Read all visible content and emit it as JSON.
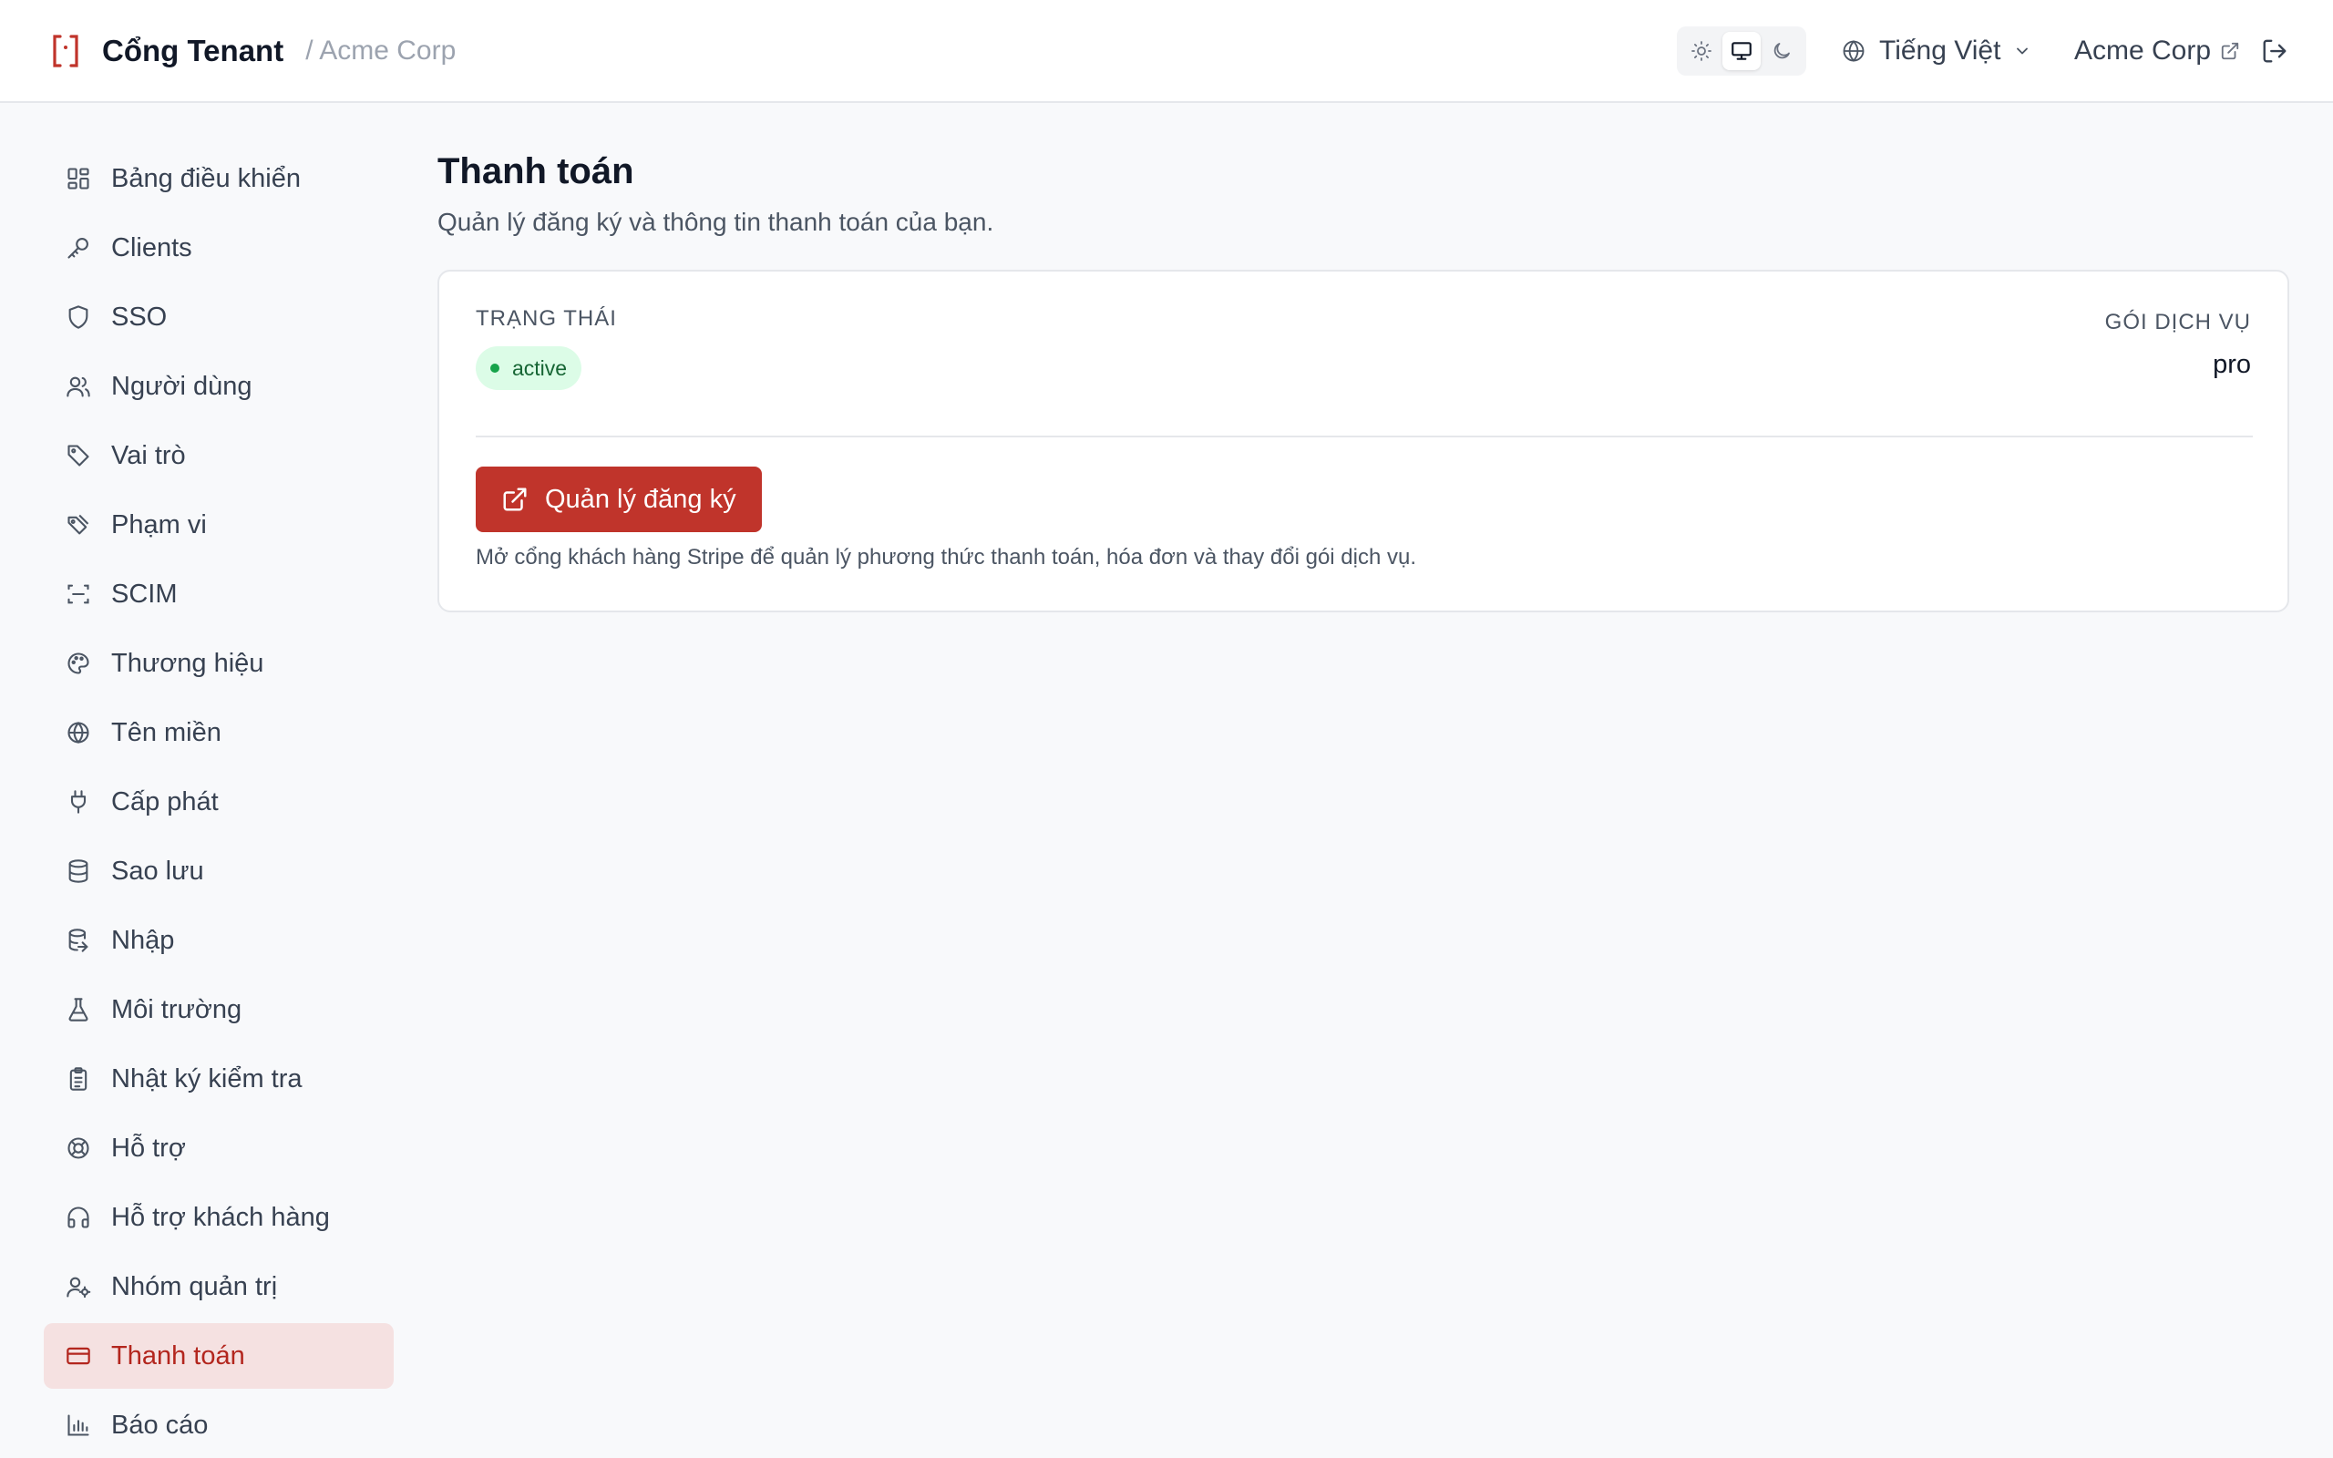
{
  "header": {
    "brand_name": "Cổng Tenant",
    "tenant_crumb": "/ Acme Corp",
    "language": "Tiếng Việt",
    "tenant_link": "Acme Corp",
    "theme_modes": [
      "light",
      "system",
      "dark"
    ],
    "active_theme": "system"
  },
  "sidebar": {
    "items": [
      {
        "label": "Bảng điều khiển",
        "icon": "dashboard-icon"
      },
      {
        "label": "Clients",
        "icon": "key-icon"
      },
      {
        "label": "SSO",
        "icon": "shield-icon"
      },
      {
        "label": "Người dùng",
        "icon": "users-icon"
      },
      {
        "label": "Vai trò",
        "icon": "tag-icon"
      },
      {
        "label": "Phạm vi",
        "icon": "tags-icon"
      },
      {
        "label": "SCIM",
        "icon": "scan-icon"
      },
      {
        "label": "Thương hiệu",
        "icon": "palette-icon"
      },
      {
        "label": "Tên miền",
        "icon": "globe-icon"
      },
      {
        "label": "Cấp phát",
        "icon": "plug-icon"
      },
      {
        "label": "Sao lưu",
        "icon": "database-icon"
      },
      {
        "label": "Nhập",
        "icon": "database-import-icon"
      },
      {
        "label": "Môi trường",
        "icon": "flask-icon"
      },
      {
        "label": "Nhật ký kiểm tra",
        "icon": "clipboard-icon"
      },
      {
        "label": "Hỗ trợ",
        "icon": "lifebuoy-icon"
      },
      {
        "label": "Hỗ trợ khách hàng",
        "icon": "headphones-icon"
      },
      {
        "label": "Nhóm quản trị",
        "icon": "user-cog-icon"
      },
      {
        "label": "Thanh toán",
        "icon": "credit-card-icon"
      },
      {
        "label": "Báo cáo",
        "icon": "bar-chart-icon"
      }
    ],
    "active_index": 17
  },
  "main": {
    "title": "Thanh toán",
    "subtitle": "Quản lý đăng ký và thông tin thanh toán của bạn.",
    "status_label": "TRẠNG THÁI",
    "status_value": "active",
    "plan_label": "GÓI DỊCH VỤ",
    "plan_value": "pro",
    "manage_button": "Quản lý đăng ký",
    "help_text": "Mở cổng khách hàng Stripe để quản lý phương thức thanh toán, hóa đơn và thay đổi gói dịch vụ."
  },
  "colors": {
    "accent": "#c0342b",
    "active_bg": "#f5e1e1",
    "status_green": "#16a34a"
  }
}
